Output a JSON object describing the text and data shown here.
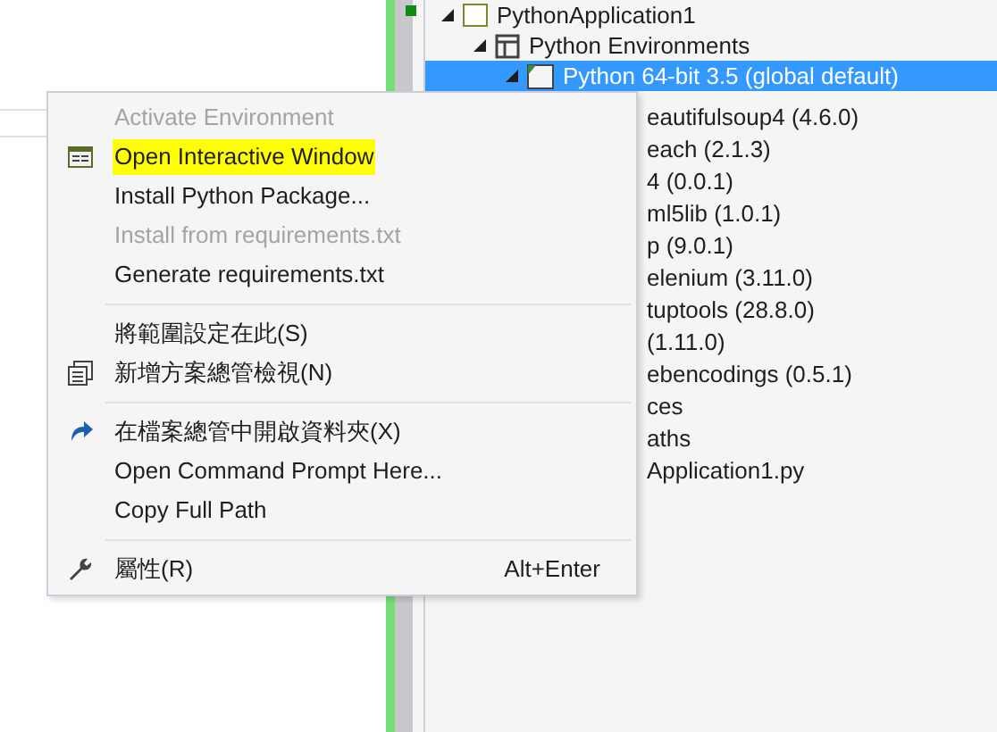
{
  "solution_tree": [
    {
      "label": "PythonApplication1",
      "expanded": true,
      "selected": false,
      "children": [
        {
          "label": "Python Environments",
          "expanded": true,
          "selected": false,
          "children": [
            {
              "label": "Python 64-bit 3.5 (global default)",
              "expanded": true,
              "selected": true,
              "children": [
                {
                  "label": "eautifulsoup4 (4.6.0)",
                  "selected": false
                },
                {
                  "label": "each (2.1.3)",
                  "selected": false
                },
                {
                  "label": "4 (0.0.1)",
                  "selected": false
                },
                {
                  "label": "ml5lib (1.0.1)",
                  "selected": false
                },
                {
                  "label": "p (9.0.1)",
                  "selected": false
                },
                {
                  "label": "elenium (3.11.0)",
                  "selected": false
                },
                {
                  "label": "tuptools (28.8.0)",
                  "selected": false
                },
                {
                  "label": "(1.11.0)",
                  "selected": false
                },
                {
                  "label": "ebencodings (0.5.1)",
                  "selected": false
                }
              ]
            }
          ]
        },
        {
          "label": "ces",
          "selected": false
        },
        {
          "label": "aths",
          "selected": false
        },
        {
          "label": "Application1.py",
          "selected": false
        }
      ]
    }
  ],
  "context_menu": {
    "items": [
      {
        "kind": "item",
        "label": "Activate Environment",
        "disabled": true,
        "highlighted": false
      },
      {
        "kind": "item",
        "label": "Open Interactive Window",
        "disabled": false,
        "highlighted": true
      },
      {
        "kind": "item",
        "label": "Install Python Package...",
        "disabled": false,
        "highlighted": false
      },
      {
        "kind": "item",
        "label": "Install from requirements.txt",
        "disabled": true,
        "highlighted": false
      },
      {
        "kind": "item",
        "label": "Generate requirements.txt",
        "disabled": false,
        "highlighted": false
      },
      {
        "kind": "separator"
      },
      {
        "kind": "item",
        "label": "將範圍設定在此(S)",
        "disabled": false,
        "highlighted": false
      },
      {
        "kind": "item",
        "label": "新增方案總管檢視(N)",
        "disabled": false,
        "highlighted": false
      },
      {
        "kind": "separator"
      },
      {
        "kind": "item",
        "label": "在檔案總管中開啟資料夾(X)",
        "disabled": false,
        "highlighted": false
      },
      {
        "kind": "item",
        "label": "Open Command Prompt Here...",
        "disabled": false,
        "highlighted": false
      },
      {
        "kind": "item",
        "label": "Copy Full Path",
        "disabled": false,
        "highlighted": false
      },
      {
        "kind": "separator"
      },
      {
        "kind": "item",
        "label": "屬性(R)",
        "shortcut": "Alt+Enter",
        "disabled": false,
        "highlighted": false
      }
    ]
  }
}
